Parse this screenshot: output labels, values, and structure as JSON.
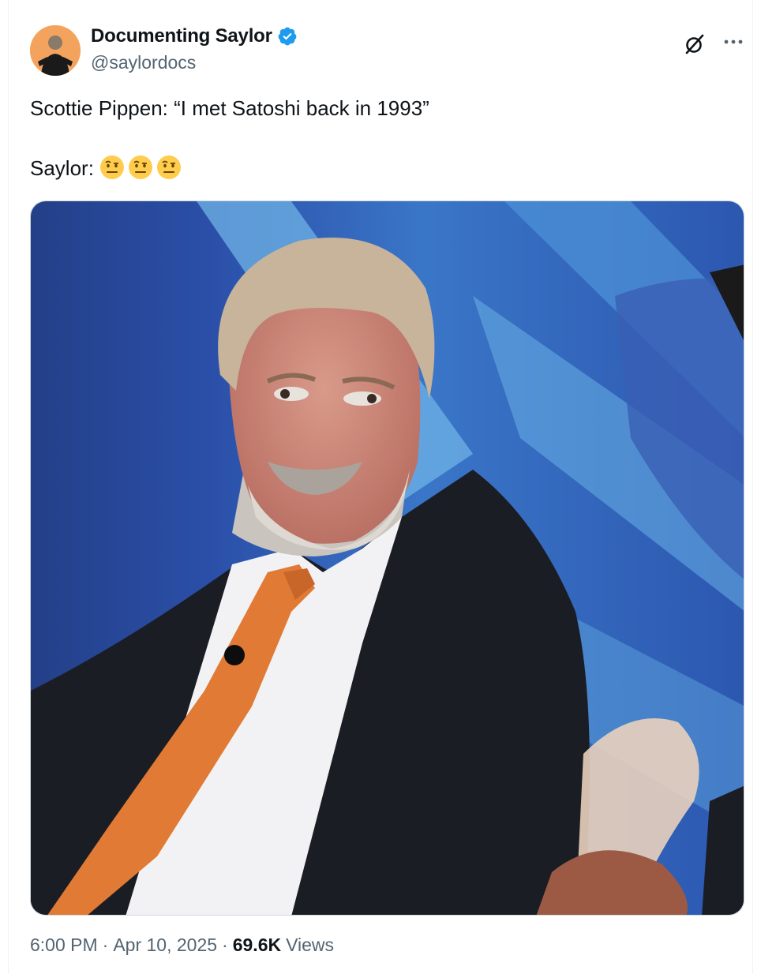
{
  "author": {
    "display_name": "Documenting Saylor",
    "handle": "@saylordocs",
    "verified": true,
    "verified_color": "#1d9bf0"
  },
  "icons": {
    "grok": "grok-icon",
    "more": "more-dots-icon",
    "verified": "verified-badge-icon",
    "emoji": "face-with-raised-eyebrow-emoji"
  },
  "tweet": {
    "line1": "Scottie Pippen: “I met Satoshi back in 1993”",
    "line2": "Saylor: "
  },
  "meta": {
    "time": "6:00 PM",
    "date": "Apr 10, 2025",
    "views_count": "69.6K",
    "views_label": "Views",
    "separator": "·"
  }
}
